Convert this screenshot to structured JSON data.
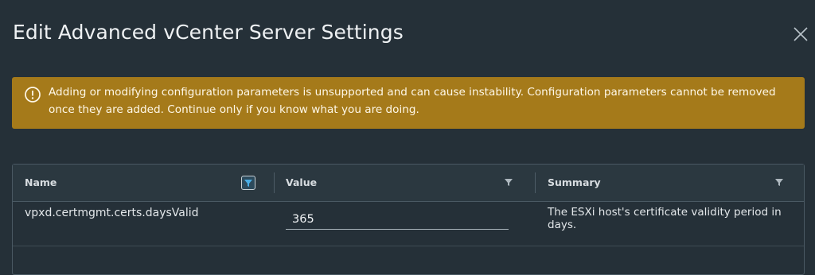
{
  "dialog": {
    "title": "Edit Advanced vCenter Server Settings",
    "close_icon": "close-icon"
  },
  "warning": {
    "icon": "warning-circle-icon",
    "text": "Adding or modifying configuration parameters is unsupported and can cause instability. Configuration parameters cannot be removed once they are added. Continue only if you know what you are doing.",
    "color": "#a57a1a"
  },
  "grid": {
    "columns": [
      {
        "label": "Name",
        "filter_active": true
      },
      {
        "label": "Value",
        "filter_active": false
      },
      {
        "label": "Summary",
        "filter_active": false
      }
    ],
    "rows": [
      {
        "name": "vpxd.certmgmt.certs.daysValid",
        "value": "365",
        "summary": "The ESXi host's certificate validity period in days."
      }
    ]
  }
}
